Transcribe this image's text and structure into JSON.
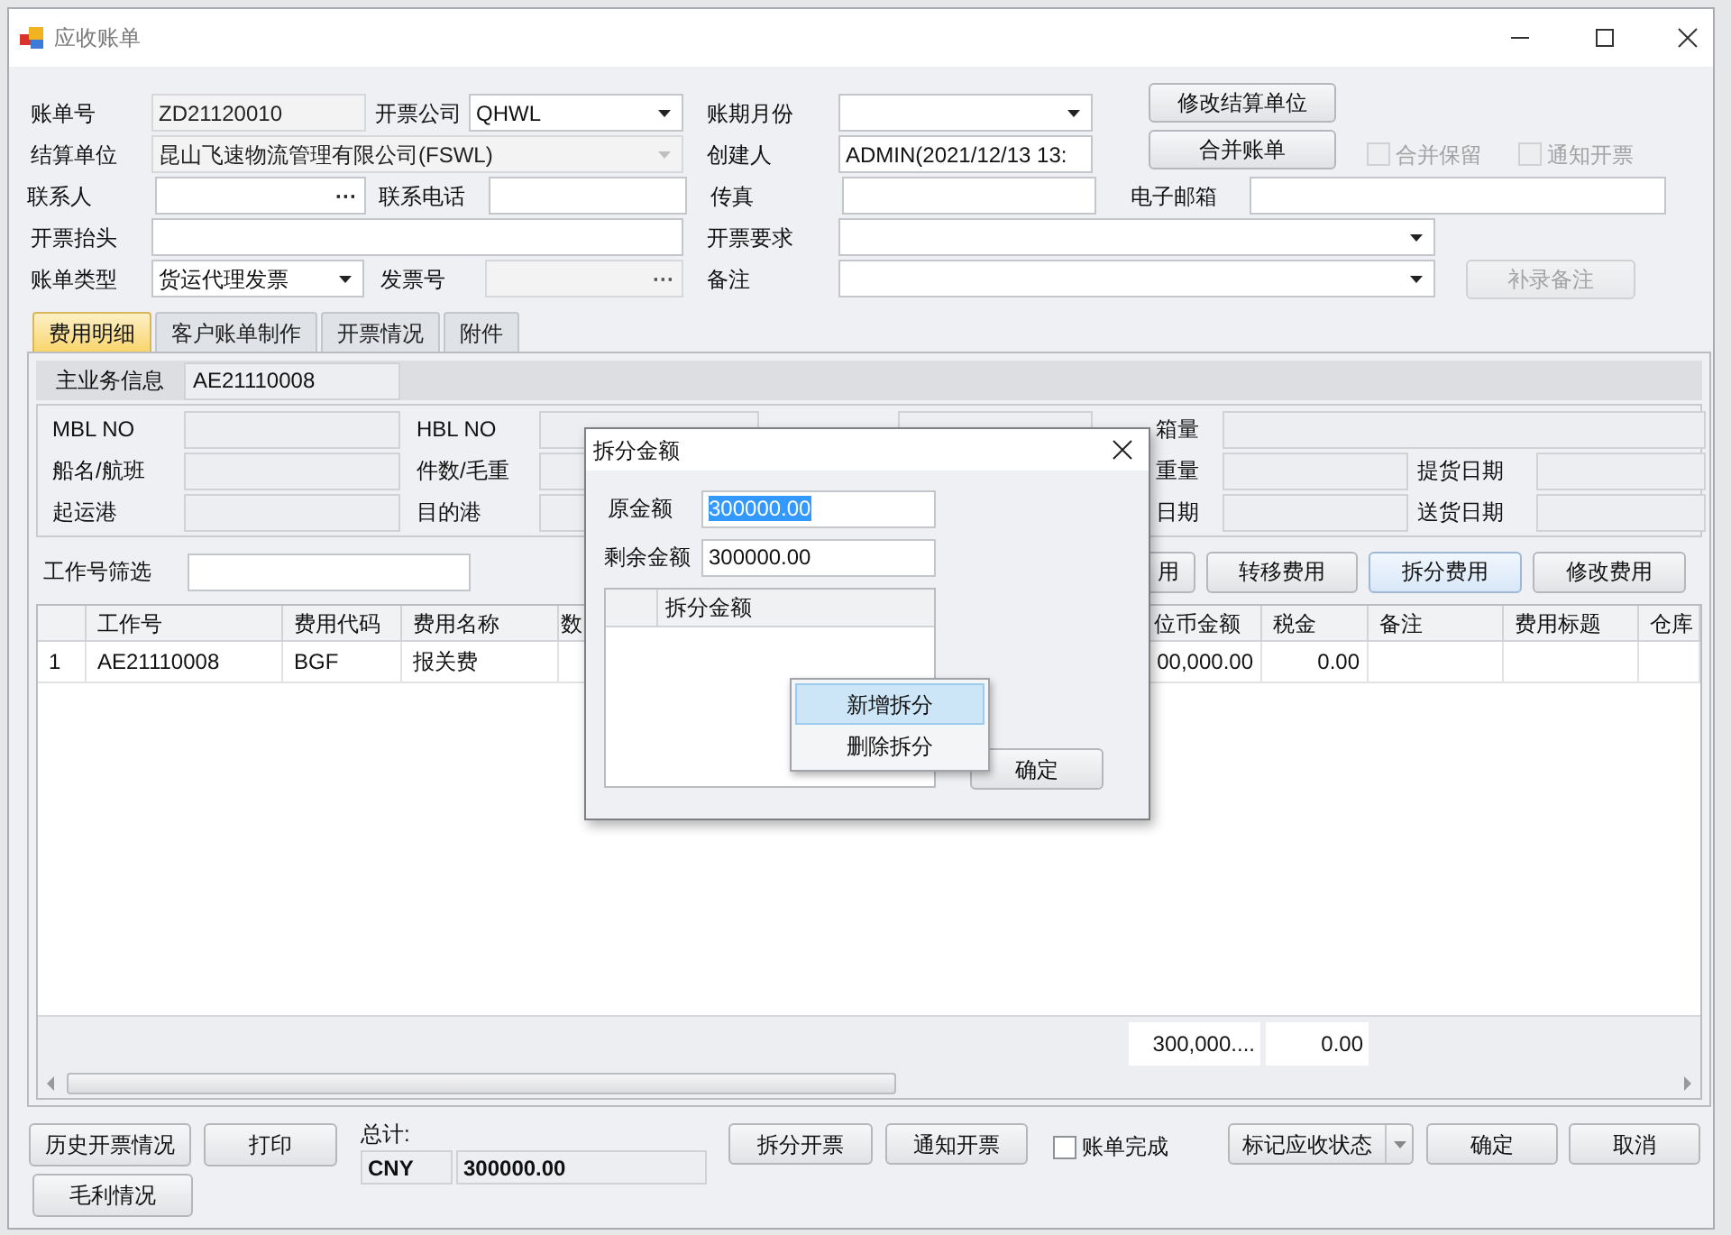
{
  "window": {
    "title": "应收账单"
  },
  "header": {
    "fields": [
      {
        "label": "账单号",
        "value": "ZD21120010",
        "kind": "text",
        "disabled": true
      },
      {
        "label": "开票公司",
        "value": "QHWL",
        "kind": "combo",
        "disabled": false
      },
      {
        "label": "账期月份",
        "kind": "combo",
        "disabled": false
      },
      {
        "label": "结算单位",
        "value": "昆山飞速物流管理有限公司(FSWL)",
        "kind": "combo",
        "disabled": true
      },
      {
        "label": "创建人",
        "value": "ADMIN(2021/12/13 13:",
        "kind": "text",
        "disabled": false
      },
      {
        "label": "联系人",
        "kind": "lookup",
        "button": "···",
        "disabled": false
      },
      {
        "label": "联系电话",
        "kind": "text",
        "disabled": false
      },
      {
        "label": "传真",
        "kind": "text",
        "disabled": false
      },
      {
        "label": "电子邮箱",
        "kind": "text",
        "disabled": false
      },
      {
        "label": "开票抬头",
        "kind": "text",
        "disabled": false
      },
      {
        "label": "开票要求",
        "kind": "combo",
        "disabled": false
      },
      {
        "label": "账单类型",
        "value": "货运代理发票",
        "kind": "combo",
        "disabled": false
      },
      {
        "label": "发票号",
        "kind": "lookup",
        "button": "···",
        "disabled": true
      },
      {
        "label": "备注",
        "kind": "combo",
        "disabled": false
      }
    ],
    "buttons": [
      {
        "label": "修改结算单位",
        "disabled": false
      },
      {
        "label": "合并账单",
        "disabled": false
      },
      {
        "label": "补录备注",
        "disabled": true
      }
    ],
    "checkboxes": [
      {
        "label": "合并保留",
        "checked": false,
        "disabled": true
      },
      {
        "label": "通知开票",
        "checked": false,
        "disabled": true
      }
    ]
  },
  "tabs": [
    {
      "label": "费用明细",
      "selected": true
    },
    {
      "label": "客户账单制作",
      "selected": false
    },
    {
      "label": "开票情况",
      "selected": false
    },
    {
      "label": "附件",
      "selected": false
    }
  ],
  "main_info": {
    "label": "主业务信息",
    "value": "AE21110008"
  },
  "info_fields": [
    {
      "label": "MBL NO"
    },
    {
      "label": "HBL NO"
    },
    {
      "label": "箱量"
    },
    {
      "label": "船名/航班"
    },
    {
      "label": "件数/毛重"
    },
    {
      "label": "重量"
    },
    {
      "label": "提货日期"
    },
    {
      "label": "起运港"
    },
    {
      "label": "目的港"
    },
    {
      "label": "日期"
    },
    {
      "label": "送货日期"
    }
  ],
  "filter": {
    "label": "工作号筛选"
  },
  "fee_buttons": [
    {
      "label": "用",
      "selected": false
    },
    {
      "label": "转移费用",
      "selected": false
    },
    {
      "label": "拆分费用",
      "selected": true
    },
    {
      "label": "修改费用",
      "selected": false
    }
  ],
  "fee_grid": {
    "columns": [
      "工作号",
      "费用代码",
      "费用名称",
      "数",
      "位币金额",
      "税金",
      "备注",
      "费用标题",
      "仓库"
    ],
    "rows": [
      {
        "row_number": "1",
        "job_no": "AE21110008",
        "fee_code": "BGF",
        "fee_name": "报关费",
        "local_amount": "00,000.00",
        "tax": "0.00"
      }
    ],
    "totals": {
      "local_amount": "300,000....",
      "tax": "0.00"
    }
  },
  "footer": {
    "buttons": [
      {
        "label": "历史开票情况"
      },
      {
        "label": "打印"
      },
      {
        "label": "拆分开票"
      },
      {
        "label": "通知开票"
      },
      {
        "label": "毛利情况"
      }
    ],
    "total_label": "总计:",
    "currency": "CNY",
    "total": "300000.00",
    "bill_done": {
      "label": "账单完成",
      "checked": false
    },
    "status_button": "标记应收状态",
    "ok": "确定",
    "cancel": "取消"
  },
  "dialog": {
    "title": "拆分金额",
    "fields": [
      {
        "label": "原金额",
        "value": "300000.00",
        "disabled": false,
        "text_selected": true
      },
      {
        "label": "剩余金额",
        "value": "300000.00",
        "disabled": false
      }
    ],
    "grid_column": "拆分金额",
    "confirm": "确定",
    "context_menu": [
      {
        "label": "新增拆分",
        "selected": true
      },
      {
        "label": "删除拆分",
        "selected": false
      }
    ]
  }
}
